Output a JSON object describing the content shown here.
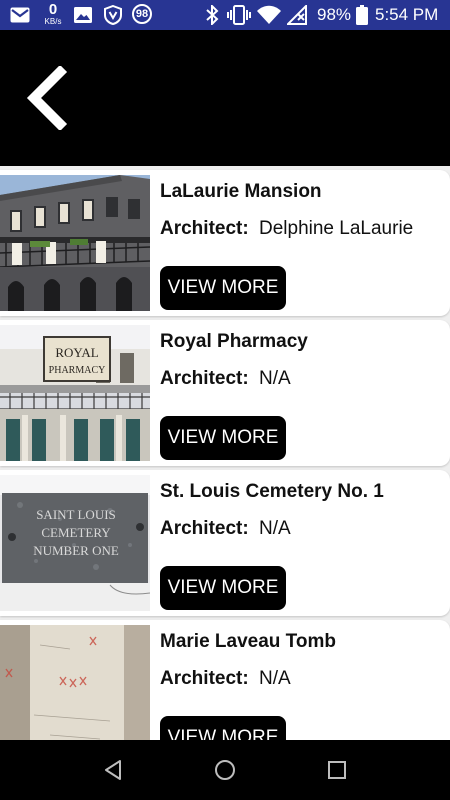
{
  "status_bar": {
    "net_speed_value": "0",
    "net_speed_unit": "KB/s",
    "notification_count": "98",
    "battery_percent": "98%",
    "time": "5:54 PM",
    "icons": [
      "gmail-icon",
      "image-icon",
      "vpn-shield-icon",
      "bluetooth-icon",
      "vibrate-icon",
      "wifi-icon",
      "no-signal-icon",
      "battery-icon"
    ]
  },
  "app_bar": {
    "back_icon": "chevron-left-icon"
  },
  "places": [
    {
      "title": "LaLaurie Mansion",
      "architect_label": "Architect:",
      "architect": "Delphine LaLaurie",
      "button_label": "VIEW MORE",
      "image": "lalaurie-mansion-photo"
    },
    {
      "title": "Royal Pharmacy",
      "architect_label": "Architect:",
      "architect": "N/A",
      "button_label": "VIEW MORE",
      "image": "royal-pharmacy-photo",
      "sign_text": [
        "ROYAL",
        "PHARMACY"
      ]
    },
    {
      "title": "St. Louis Cemetery No. 1",
      "architect_label": "Architect:",
      "architect": "N/A",
      "button_label": "VIEW MORE",
      "image": "cemetery-plaque-photo",
      "sign_text": [
        "SAINT LOUIS",
        "CEMETERY",
        "NUMBER ONE"
      ]
    },
    {
      "title": "Marie Laveau Tomb",
      "architect_label": "Architect:",
      "architect": "N/A",
      "button_label": "VIEW MORE",
      "image": "laveau-tomb-photo"
    }
  ],
  "nav_bar": {
    "icons": [
      "back-triangle-icon",
      "home-circle-icon",
      "recents-square-icon"
    ]
  },
  "colors": {
    "status_bar": "#283593",
    "app_bar": "#000000",
    "button": "#000000",
    "background": "#efefef"
  }
}
